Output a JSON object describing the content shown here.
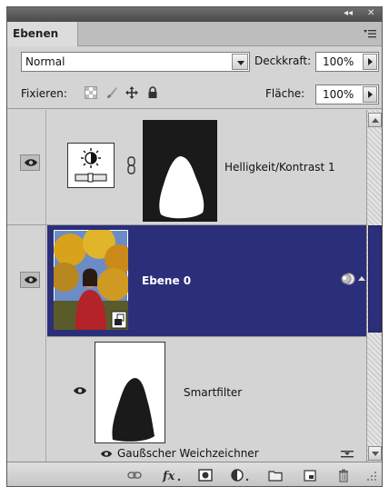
{
  "panel": {
    "tab_label": "Ebenen",
    "window_controls": {
      "collapse": "◂◂",
      "close": "✕"
    }
  },
  "options": {
    "blend_mode": "Normal",
    "opacity_label": "Deckkraft:",
    "opacity_value": "100%",
    "lock_label": "Fixieren:",
    "fill_label": "Fläche:",
    "fill_value": "100%"
  },
  "layers": [
    {
      "name": "Helligkeit/Kontrast 1",
      "type": "adjustment",
      "selected": false,
      "visible": true
    },
    {
      "name": "Ebene 0",
      "type": "smart-object",
      "selected": true,
      "visible": true
    },
    {
      "name": "Smartfilter",
      "type": "smart-filter-mask",
      "selected": false,
      "visible": true
    },
    {
      "name": "Gaußscher Weichzeichner",
      "type": "filter",
      "selected": false,
      "visible": true
    }
  ],
  "colors": {
    "selection": "#2b2f7a",
    "panel_bg": "#d4d4d4"
  },
  "bottom_icons": [
    "link-icon",
    "fx-icon",
    "mask-icon",
    "adjustment-icon",
    "folder-icon",
    "new-layer-icon",
    "trash-icon"
  ]
}
